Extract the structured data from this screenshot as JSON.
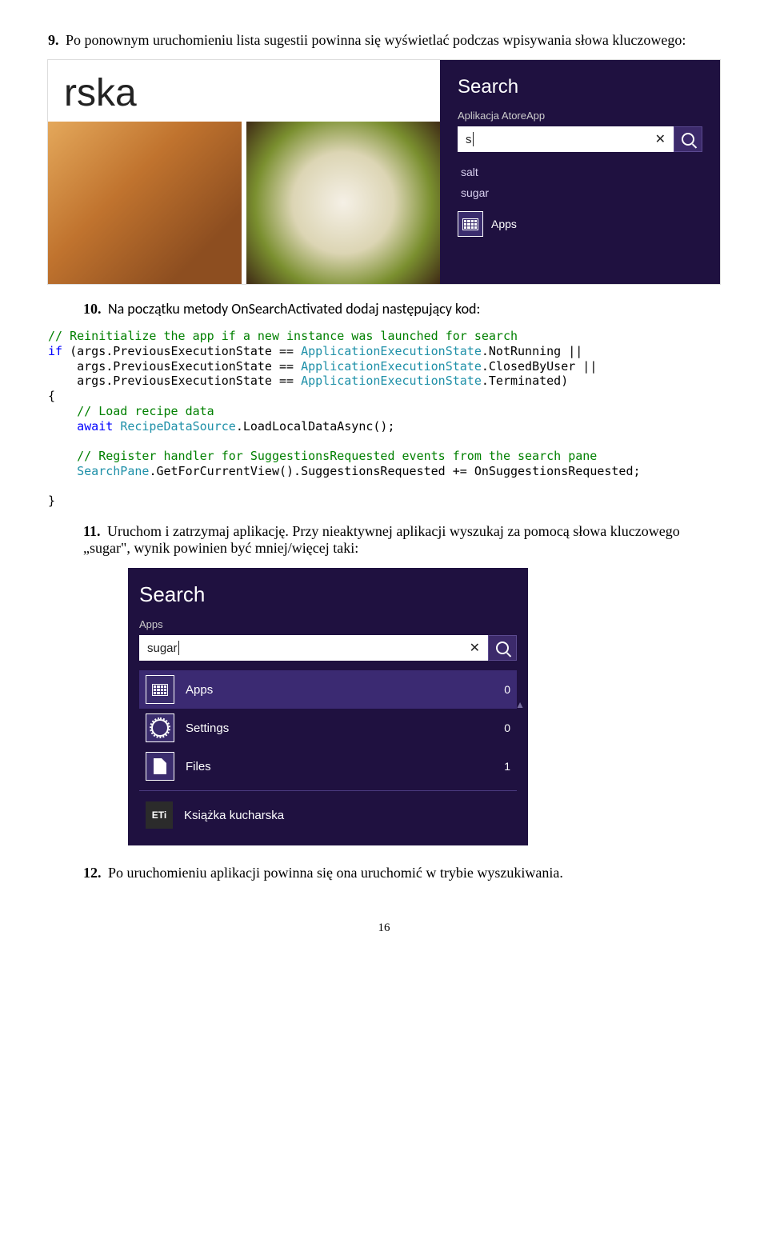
{
  "step9": {
    "num": "9.",
    "text": "Po ponownym uruchomieniu lista sugestii powinna się wyświetlać podczas wpisywania słowa kluczowego:"
  },
  "shot1": {
    "food_title": "rska",
    "pane_title": "Search",
    "pane_sub": "Aplikacja AtoreApp",
    "query": "s",
    "clear": "✕",
    "suggestions": [
      "salt",
      "sugar"
    ],
    "apps_label": "Apps"
  },
  "step10": {
    "num": "10.",
    "text": "Na początku metody OnSearchActivated dodaj następujący kod:"
  },
  "code": {
    "l1": "// Reinitialize the app if a new instance was launched for search",
    "l2a": "if",
    "l2b": " (args.PreviousExecutionState == ",
    "l2c": "ApplicationExecutionState",
    "l2d": ".NotRunning ||",
    "l3a": "    args.PreviousExecutionState == ",
    "l3b": "ApplicationExecutionState",
    "l3c": ".ClosedByUser ||",
    "l4a": "    args.PreviousExecutionState == ",
    "l4b": "ApplicationExecutionState",
    "l4c": ".Terminated)",
    "l5": "{",
    "l6": "    // Load recipe data",
    "l7a": "    await",
    "l7b": " ",
    "l7c": "RecipeDataSource",
    "l7d": ".LoadLocalDataAsync();",
    "l8": " ",
    "l9": "    // Register handler for SuggestionsRequested events from the search pane",
    "l10a": "    ",
    "l10b": "SearchPane",
    "l10c": ".GetForCurrentView().SuggestionsRequested += OnSuggestionsRequested;",
    "l11": " ",
    "l12": "}"
  },
  "step11": {
    "num": "11.",
    "text": "Uruchom i zatrzymaj aplikację. Przy nieaktywnej aplikacji wyszukaj za pomocą słowa kluczowego „sugar\", wynik powinien być mniej/więcej taki:"
  },
  "shot2": {
    "title": "Search",
    "sub": "Apps",
    "query": "sugar",
    "clear": "✕",
    "rows": [
      {
        "label": "Apps",
        "count": "0"
      },
      {
        "label": "Settings",
        "count": "0"
      },
      {
        "label": "Files",
        "count": "1"
      }
    ],
    "app_row": "Książka kucharska"
  },
  "step12": {
    "num": "12.",
    "text": "Po uruchomieniu aplikacji powinna się ona uruchomić w trybie wyszukiwania."
  },
  "page_num": "16"
}
